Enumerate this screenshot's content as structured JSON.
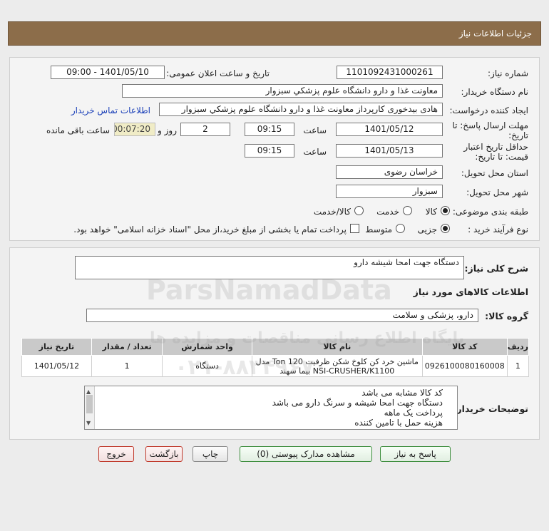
{
  "header": {
    "title": "جزئیات اطلاعات نیاز"
  },
  "form": {
    "need_number_label": "شماره نیاز:",
    "need_number": "1101092431000261",
    "announce_label": "تاریخ و ساعت اعلان عمومی:",
    "announce_value": "1401/05/10 - 09:00",
    "buyer_label": "نام دستگاه خریدار:",
    "buyer_value": "معاونت غذا و دارو   دانشگاه علوم پزشكي سبزوار",
    "creator_label": "ایجاد کننده درخواست:",
    "creator_value": "هادی بیدخوری کارپرداز معاونت غذا و دارو   دانشگاه علوم پزشكي سبزوار",
    "contact_link": "اطلاعات تماس خریدار",
    "deadline_label": "مهلت ارسال پاسخ: تا تاریخ:",
    "deadline_date": "1401/05/12",
    "time_label": "ساعت",
    "deadline_time": "09:15",
    "days_value": "2",
    "days_label": "روز و",
    "remaining_value": "00:07:20",
    "remaining_label": "ساعت باقی مانده",
    "validity_label": "حداقل تاریخ اعتبار قیمت: تا تاریخ:",
    "validity_date": "1401/05/13",
    "validity_time": "09:15",
    "province_label": "استان محل تحویل:",
    "province_value": "خراسان رضوی",
    "city_label": "شهر محل تحویل:",
    "city_value": "سبزوار",
    "category_label": "طبقه بندی موضوعی:",
    "category_options": [
      "کالا",
      "خدمت",
      "کالا/خدمت"
    ],
    "process_label": "نوع فرآیند خرید :",
    "process_options": [
      "جزیی",
      "متوسط"
    ],
    "payment_note": "پرداخت تمام یا بخشی از مبلغ خرید،از محل \"اسناد خزانه اسلامی\" خواهد بود."
  },
  "details": {
    "summary_label": "شرح کلی نیاز:",
    "summary_value": "دستگاه جهت امحا شیشه دارو",
    "goods_info_title": "اطلاعات کالاهای مورد نیاز",
    "group_label": "گروه کالا:",
    "group_value": "دارو، پزشکی و سلامت",
    "table": {
      "headers": [
        "ردیف",
        "کد کالا",
        "نام کالا",
        "واحد شمارش",
        "تعداد / مقدار",
        "تاریخ نیاز"
      ],
      "rows": [
        [
          "1",
          "0926100080160008",
          "ماشین خرد کن کلوخ شکن ظرفیت 120 Ton مدل NSI-CRUSHER/K1100 بیما سهند",
          "دستگاه",
          "1",
          "1401/05/12"
        ]
      ]
    },
    "buyer_notes_label": "توضیحات خریدار:",
    "buyer_notes": [
      "کد کالا مشابه می باشد",
      "دستگاه جهت امحا شیشه و سرنگ دارو می باشد",
      "پرداخت یک ماهه",
      "هزینه حمل با تامین کننده"
    ]
  },
  "buttons": {
    "reply": "پاسخ به نیاز",
    "attachments": "مشاهده مدارک پیوستی (0)",
    "print": "چاپ",
    "back": "بازگشت",
    "exit": "خروج"
  },
  "watermark": {
    "brand": "ParsNamadData",
    "sub": "پایگاه اطلاع رسانی مناقصات و مزایده ها",
    "phone": "۰۲۱-۸۸۳۴۹۶۷۰"
  },
  "colors": {
    "header_bg": "#8c6d4a",
    "link": "#1a3fb8",
    "timer_bg": "#f0ecc6"
  }
}
